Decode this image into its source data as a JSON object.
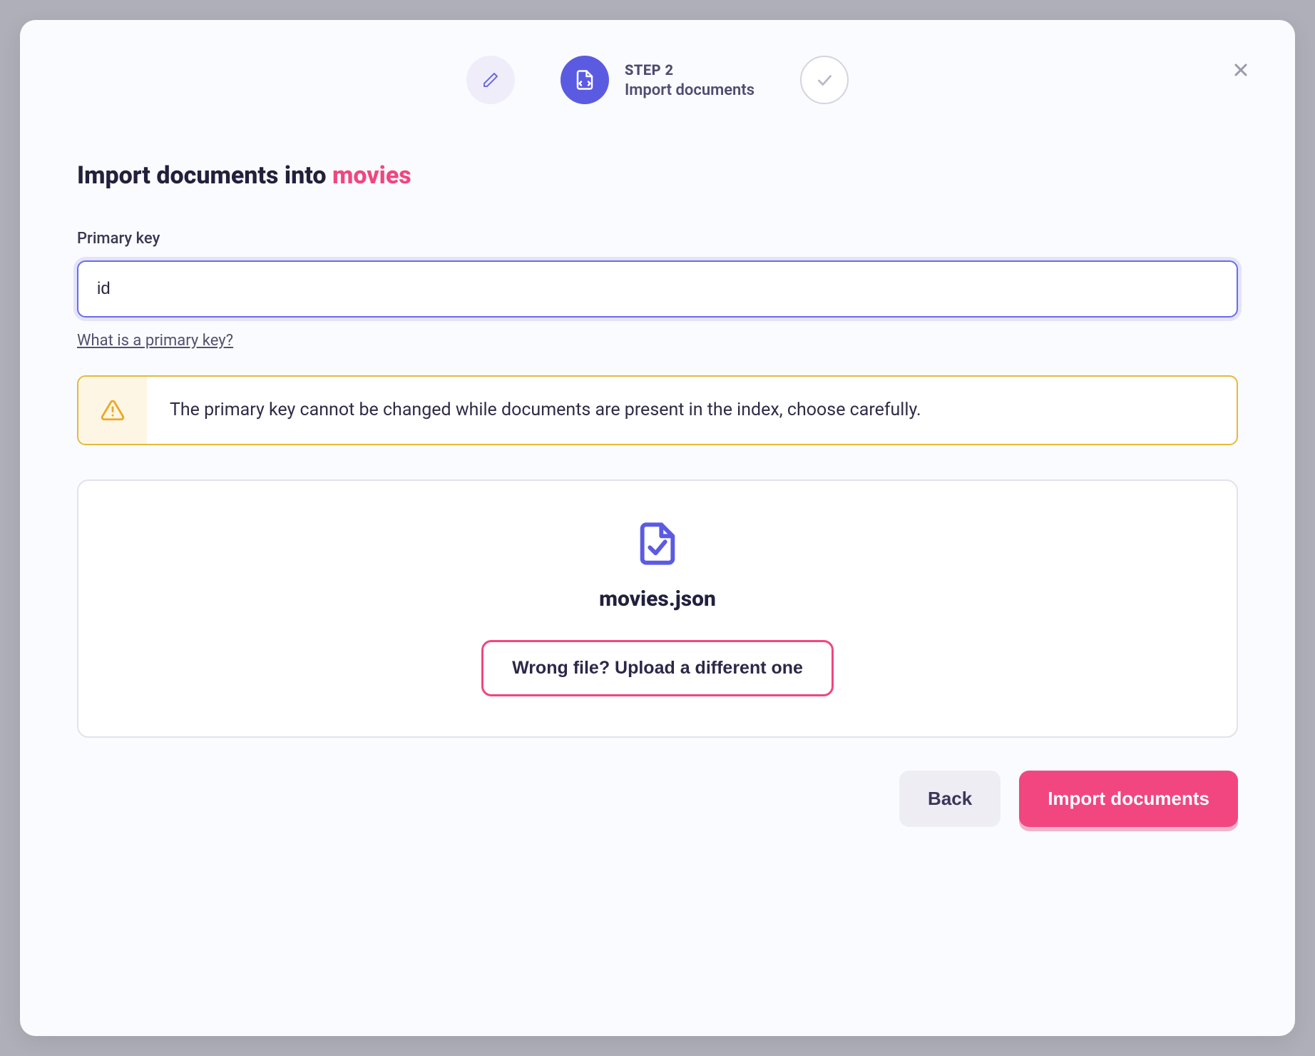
{
  "stepper": {
    "step2_label": "STEP 2",
    "step2_desc": "Import documents"
  },
  "title": {
    "prefix": "Import documents into ",
    "highlight": "movies"
  },
  "primary_key": {
    "label": "Primary key",
    "value": "id",
    "help_link": "What is a primary key?"
  },
  "alert": {
    "text": "The primary key cannot be changed while documents are present in the index, choose carefully."
  },
  "file": {
    "name": "movies.json",
    "upload_label": "Wrong file? Upload a different one"
  },
  "actions": {
    "back": "Back",
    "import": "Import documents"
  }
}
